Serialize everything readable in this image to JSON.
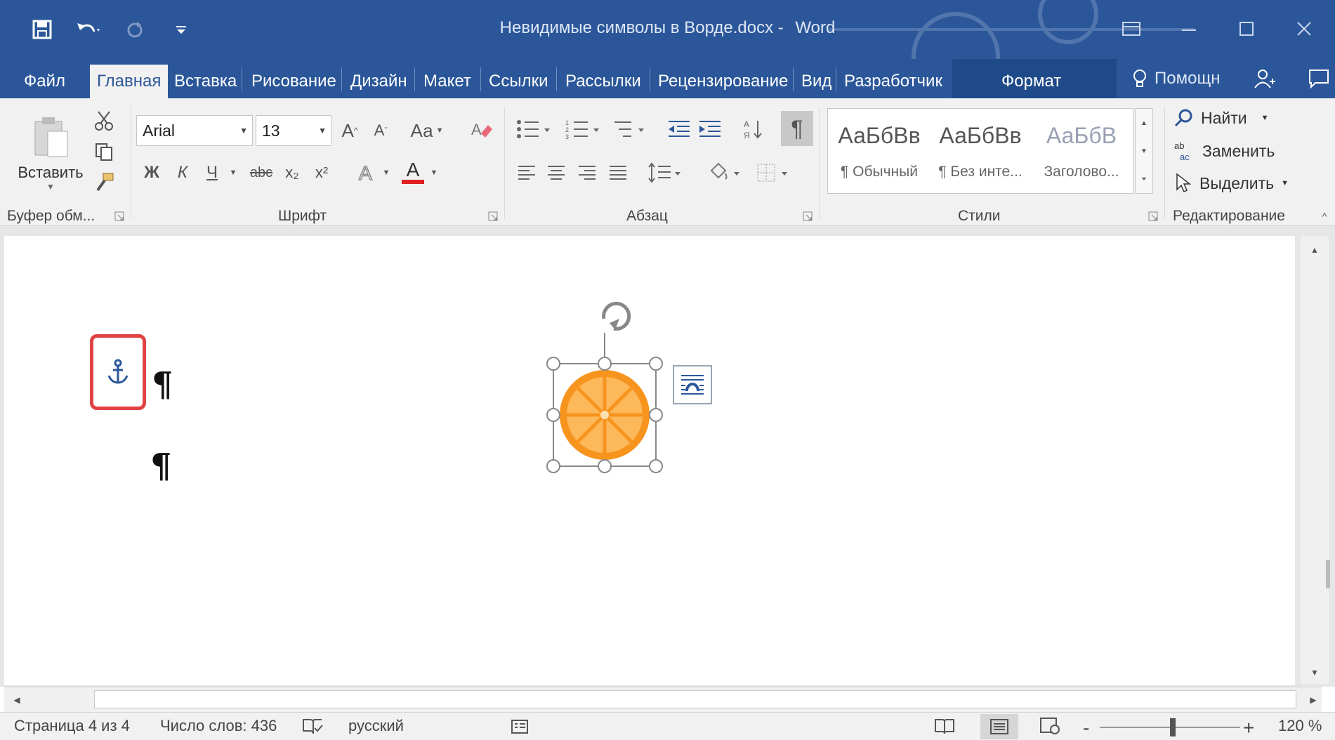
{
  "window": {
    "title": "Невидимые символы в Ворде.docx",
    "separator": "-",
    "app": "Word"
  },
  "tabs": {
    "file": "Файл",
    "home": "Главная",
    "insert": "Вставка",
    "draw": "Рисование",
    "design": "Дизайн",
    "layout": "Макет",
    "references": "Ссылки",
    "mailings": "Рассылки",
    "review": "Рецензирование",
    "view": "Вид",
    "developer": "Разработчик",
    "format": "Формат",
    "help": "Помощн"
  },
  "ribbon": {
    "clipboard": {
      "paste": "Вставить",
      "label": "Буфер обм..."
    },
    "font": {
      "name": "Arial",
      "size": "13",
      "change_case": "Аа",
      "bold": "Ж",
      "italic": "К",
      "underline": "Ч",
      "strike": "abc",
      "subscript": "x₂",
      "superscript": "x²",
      "color_letter": "А",
      "label": "Шрифт"
    },
    "paragraph": {
      "label": "Абзац",
      "pilcrow": "¶"
    },
    "styles": {
      "label": "Стили",
      "items": [
        {
          "sample": "АаБбВв",
          "name": "¶ Обычный"
        },
        {
          "sample": "АаБбВв",
          "name": "¶ Без инте..."
        },
        {
          "sample": "АаБбВ",
          "name": "Заголово..."
        }
      ]
    },
    "editing": {
      "find": "Найти",
      "replace": "Заменить",
      "select": "Выделить",
      "label": "Редактирование"
    }
  },
  "document": {
    "pilcrow": "¶"
  },
  "status": {
    "page": "Страница 4 из 4",
    "words": "Число слов: 436",
    "language": "русский",
    "zoom": "120 %",
    "zoom_minus": "-",
    "zoom_plus": "+"
  },
  "colors": {
    "brand": "#2b579a",
    "highlight": "#e04343",
    "orange": "#f7941d"
  }
}
